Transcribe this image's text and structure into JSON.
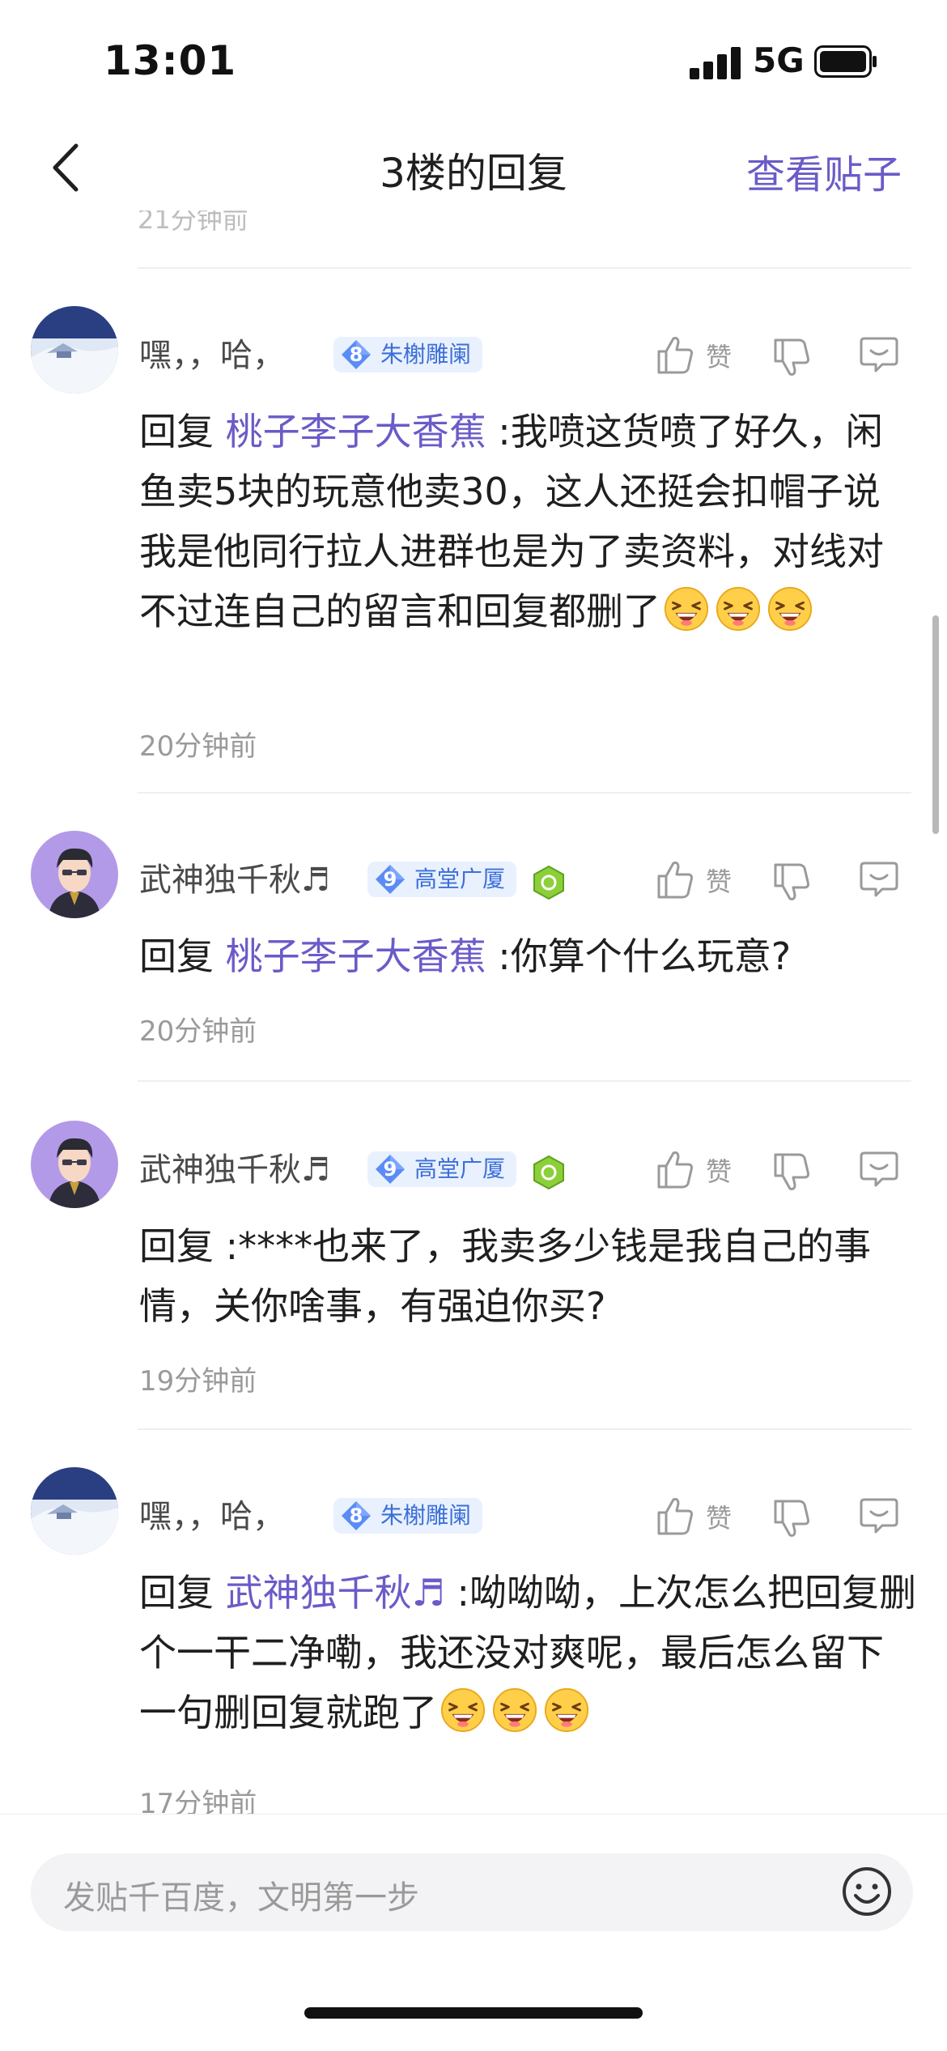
{
  "status_bar": {
    "time": "13:01",
    "network": "5G"
  },
  "nav": {
    "title": "3楼的回复",
    "view_post": "查看贴子"
  },
  "partial_timestamp": "21分钟前",
  "comments": [
    {
      "username": "嘿，，哈，",
      "badge_level": "8",
      "badge_title": "朱榭雕阑",
      "like_label": "赞",
      "reply_prefix": "回复",
      "mention": "桃子李子大香蕉",
      "text": " :我喷这货喷了好久，闲鱼卖5块的玩意他卖30，这人还挺会扣帽子说我是他同行拉人进群也是为了卖资料，对线对不过连自己的留言和回复都删了",
      "emoji_count": 3,
      "time": "20分钟前"
    },
    {
      "username": "武神独千秋♬",
      "badge_level": "9",
      "badge_title": "高堂广厦",
      "like_label": "赞",
      "reply_prefix": "回复",
      "mention": "桃子李子大香蕉",
      "text": " :你算个什么玩意?",
      "time": "20分钟前"
    },
    {
      "username": "武神独千秋♬",
      "badge_level": "9",
      "badge_title": "高堂广厦",
      "like_label": "赞",
      "reply_prefix": "回复",
      "text": " :****也来了，我卖多少钱是我自己的事情，关你啥事，有强迫你买?",
      "time": "19分钟前"
    },
    {
      "username": "嘿，，哈，",
      "badge_level": "8",
      "badge_title": "朱榭雕阑",
      "like_label": "赞",
      "reply_prefix": "回复",
      "mention": "武神独千秋♬",
      "text": " :呦呦呦，上次怎么把回复删个一干二净嘞，我还没对爽呢，最后怎么留下一句删回复就跑了",
      "emoji_count": 3,
      "time": "17分钟前"
    }
  ],
  "composer": {
    "placeholder": "发贴千百度，文明第一步"
  },
  "colors": {
    "accent": "#6a5bc8",
    "badge_bg": "#e9f1fe",
    "badge_text": "#3d6fd8",
    "muted": "#9a9a9a"
  }
}
